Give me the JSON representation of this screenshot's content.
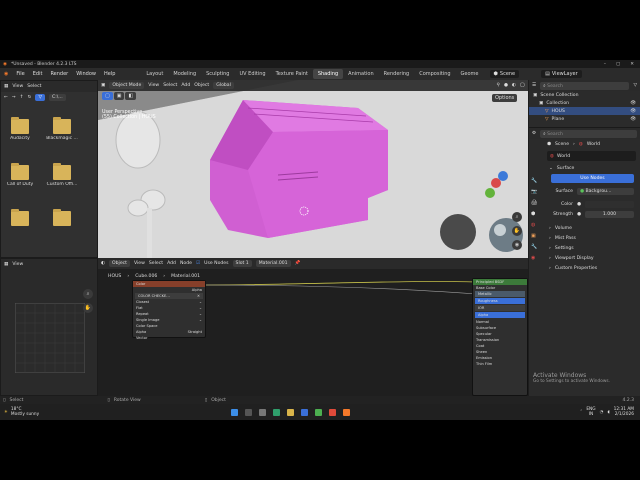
{
  "title_bar": {
    "title": "*Unsaved - Blender 4.2.3 LTS"
  },
  "menu": {
    "items": [
      "File",
      "Edit",
      "Render",
      "Window",
      "Help"
    ]
  },
  "workspaces": {
    "tabs": [
      "Layout",
      "Modeling",
      "Sculpting",
      "UV Editing",
      "Texture Paint",
      "Shading",
      "Animation",
      "Rendering",
      "Compositing",
      "Geome"
    ],
    "active": "Shading"
  },
  "scene_selector": {
    "label": "Scene"
  },
  "viewlayer_selector": {
    "label": "ViewLayer"
  },
  "file_browser": {
    "view_label": "View",
    "select_label": "Select",
    "path_label": "C:\\...",
    "folders": [
      "Audacity",
      "Blackmagic ...",
      "Call of Duty",
      "Custom Offi...",
      "",
      ""
    ]
  },
  "viewport": {
    "mode_label": "Object Mode",
    "menus": [
      "View",
      "Select",
      "Add",
      "Object"
    ],
    "orientation": "Global",
    "options_label": "Options",
    "info_line1": "User Perspective",
    "info_line2": "(55) Collection | HOUS"
  },
  "image_editor": {
    "view_label": "View"
  },
  "node_editor": {
    "object_label": "Object",
    "menus": [
      "View",
      "Select",
      "Add",
      "Node"
    ],
    "use_nodes_label": "Use Nodes",
    "slot_label": "Slot 1",
    "material_label": "Material.001",
    "breadcrumb": [
      "HOUS",
      "Cube.006",
      "Material.001"
    ],
    "texture_node": {
      "title": "Color",
      "alpha_label": "Alpha",
      "image_name": "COLOR CHECKE...",
      "rows": [
        "Closest",
        "Flat",
        "Repeat",
        "Single Image",
        "Color Space",
        "Alpha",
        "Vector"
      ],
      "alpha_value": "Straight"
    },
    "bsdf_node": {
      "title": "Principled BSDF",
      "rows": [
        "Base Color",
        "Metallic",
        "Roughness",
        "IOR",
        "Alpha",
        "Normal"
      ],
      "sections": [
        "Subsurface",
        "Specular",
        "Transmission",
        "Coat",
        "Sheen",
        "Emission",
        "Thin Film"
      ]
    }
  },
  "outliner": {
    "search_placeholder": "Search",
    "scene_collection": "Scene Collection",
    "items": [
      "Collection",
      "HOUS",
      "Plane"
    ]
  },
  "properties": {
    "search_placeholder": "Search",
    "breadcrumb_scene": "Scene",
    "breadcrumb_world": "World",
    "world_name": "World",
    "surface_panel": "Surface",
    "use_nodes_label": "Use Nodes",
    "surface_label": "Surface",
    "surface_value": "Backgrou...",
    "color_label": "Color",
    "strength_label": "Strength",
    "strength_value": "1.000",
    "panels": [
      "Volume",
      "Mist Pass",
      "Settings",
      "Viewport Display",
      "Custom Properties"
    ]
  },
  "status_bar": {
    "select": "Select",
    "rotate": "Rotate View",
    "object": "Object",
    "version": "4.2.3"
  },
  "watermark": {
    "line1": "Activate Windows",
    "line2": "Go to Settings to activate Windows."
  },
  "taskbar": {
    "weather_temp": "18°C",
    "weather_desc": "Mostly sunny",
    "lang1": "ENG",
    "lang2": "IN",
    "time": "12:31 AM",
    "date": "2/1/2026"
  }
}
